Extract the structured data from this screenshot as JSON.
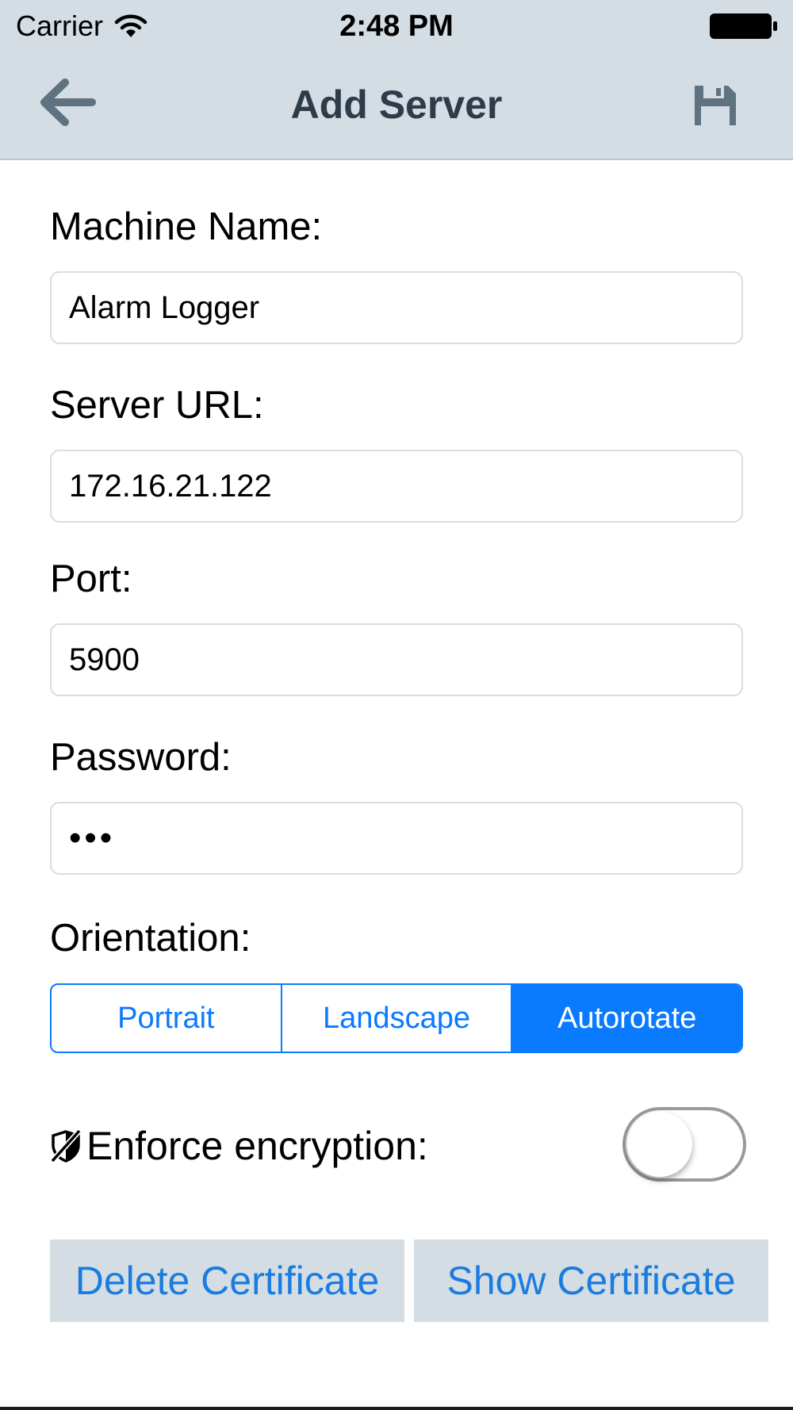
{
  "status_bar": {
    "carrier": "Carrier",
    "time": "2:48 PM"
  },
  "nav": {
    "title": "Add Server",
    "back_icon": "arrow-left-icon",
    "save_icon": "floppy-disk-icon"
  },
  "form": {
    "machine_name": {
      "label": "Machine Name:",
      "value": "Alarm Logger"
    },
    "server_url": {
      "label": "Server URL:",
      "value": "172.16.21.122"
    },
    "port": {
      "label": "Port:",
      "value": "5900"
    },
    "password": {
      "label": "Password:",
      "value": "•••"
    },
    "orientation": {
      "label": "Orientation:",
      "options": [
        "Portrait",
        "Landscape",
        "Autorotate"
      ],
      "selected": "Autorotate"
    },
    "encryption": {
      "label": "Enforce encryption:",
      "icon": "no-encryption-shield-icon",
      "enabled": false
    }
  },
  "buttons": {
    "delete_certificate": "Delete Certificate",
    "show_certificate": "Show Certificate"
  },
  "colors": {
    "accent": "#0a7aff",
    "bar_background": "#d3dde3",
    "title_text": "#2e3b48",
    "icon_gray": "#5f7280"
  }
}
